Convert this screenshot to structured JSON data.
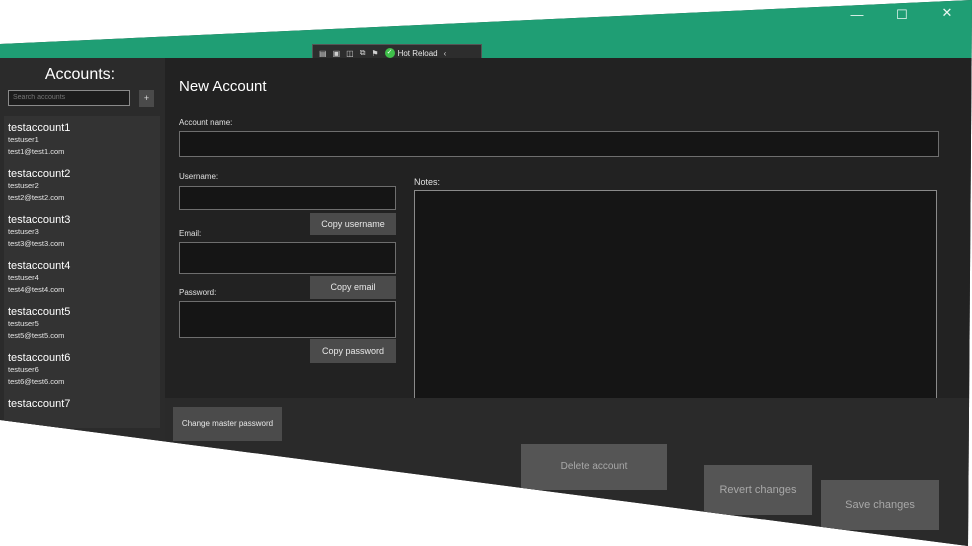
{
  "window": {
    "title": "",
    "minimize_icon": "minimize-icon",
    "maximize_icon": "maximize-icon",
    "close_icon": "close-icon",
    "brand_color": "#1f9e74"
  },
  "debug_toolbar": {
    "hot_reload_label": "Hot Reload",
    "collapse_glyph": "‹"
  },
  "sidebar": {
    "title": "Accounts:",
    "search_placeholder": "Search accounts",
    "add_label": "+",
    "accounts": [
      {
        "name": "testaccount1",
        "username": "testuser1",
        "email": "test1@test1.com"
      },
      {
        "name": "testaccount2",
        "username": "testuser2",
        "email": "test2@test2.com"
      },
      {
        "name": "testaccount3",
        "username": "testuser3",
        "email": "test3@test3.com"
      },
      {
        "name": "testaccount4",
        "username": "testuser4",
        "email": "test4@test4.com"
      },
      {
        "name": "testaccount5",
        "username": "testuser5",
        "email": "test5@test5.com"
      },
      {
        "name": "testaccount6",
        "username": "testuser6",
        "email": "test6@test6.com"
      },
      {
        "name": "testaccount7",
        "username": "",
        "email": ""
      }
    ]
  },
  "form": {
    "heading": "New Account",
    "account_name_label": "Account name:",
    "account_name_value": "",
    "username_label": "Username:",
    "username_value": "",
    "copy_username_label": "Copy username",
    "email_label": "Email:",
    "email_value": "",
    "copy_email_label": "Copy email",
    "password_label": "Password:",
    "password_value": "",
    "copy_password_label": "Copy password",
    "notes_label": "Notes:",
    "notes_value": ""
  },
  "footer": {
    "change_master_password_label": "Change master password",
    "delete_account_label": "Delete account",
    "revert_changes_label": "Revert changes",
    "save_changes_label": "Save changes"
  }
}
